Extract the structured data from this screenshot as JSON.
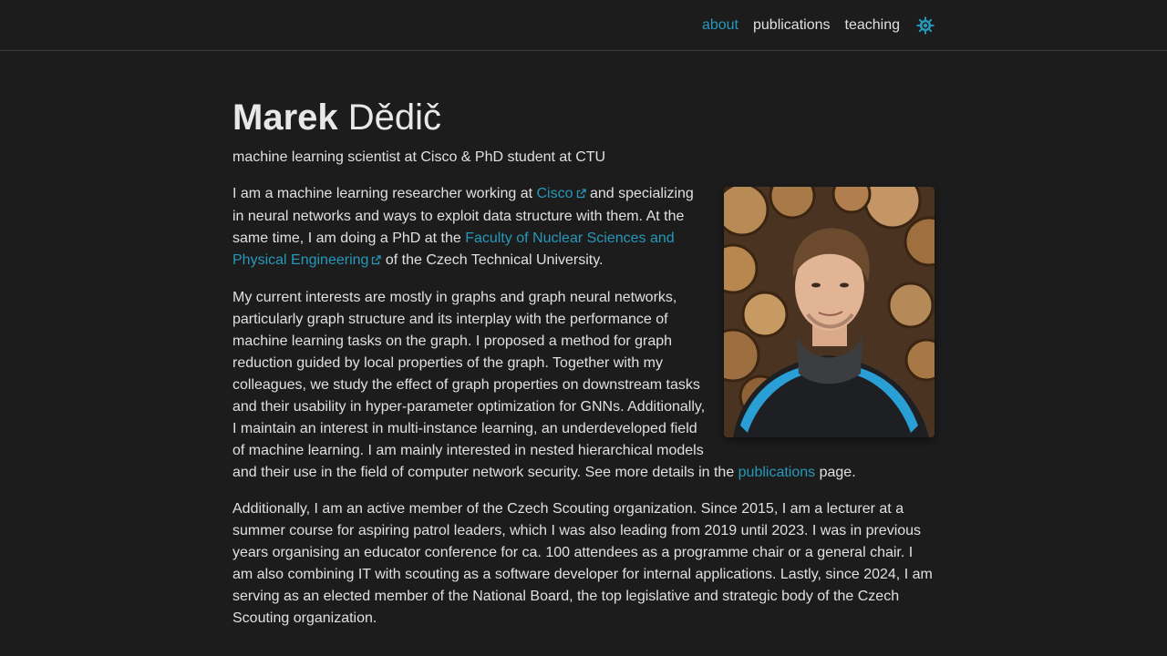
{
  "nav": {
    "items": [
      {
        "label": "about",
        "active": true
      },
      {
        "label": "publications",
        "active": false
      },
      {
        "label": "teaching",
        "active": false
      }
    ],
    "theme_icon": "sun-icon"
  },
  "header": {
    "first_name": "Marek",
    "last_name": "Dědič",
    "description": "machine learning scientist at Cisco & PhD student at CTU"
  },
  "profile": {
    "icon": "profile-photo",
    "alt": "portrait photo"
  },
  "bio": {
    "p1_a": "I am a machine learning researcher working at ",
    "p1_link_cisco": "Cisco",
    "p1_b": " and specializing in neural networks and ways to exploit data structure with them. At the same time, I am doing a PhD at the ",
    "p1_link_faculty": "Faculty of Nuclear Sciences and Physical Engineering",
    "p1_c": " of the Czech Technical University.",
    "p2_a": "My current interests are mostly in graphs and graph neural networks, particularly graph structure and its interplay with the performance of machine learning tasks on the graph. I proposed a method for graph reduction guided by local properties of the graph. Together with my colleagues, we study the effect of graph properties on downstream tasks and their usability in hyper-parameter optimization for GNNs. Additionally, I maintain an interest in multi-instance learning, an underdeveloped field of machine learning. I am mainly interested in nested hierarchical models and their use in the field of computer network security. See more details in the ",
    "p2_link_pubs": "publications",
    "p2_b": " page.",
    "p3": "Additionally, I am an active member of the Czech Scouting organization. Since 2015, I am a lecturer at a summer course for aspiring patrol leaders, which I was also leading from 2019 until 2023. I was in previous years organising an educator conference for ca. 100 attendees as a programme chair or a general chair. I am also combining IT with scouting as a software developer for internal applications. Lastly, since 2024, I am serving as an elected member of the National Board, the top legislative and strategic body of the Czech Scouting organization."
  },
  "colors": {
    "accent": "#2698ba",
    "background": "#1c1c1d",
    "text": "#e0e0e0"
  }
}
